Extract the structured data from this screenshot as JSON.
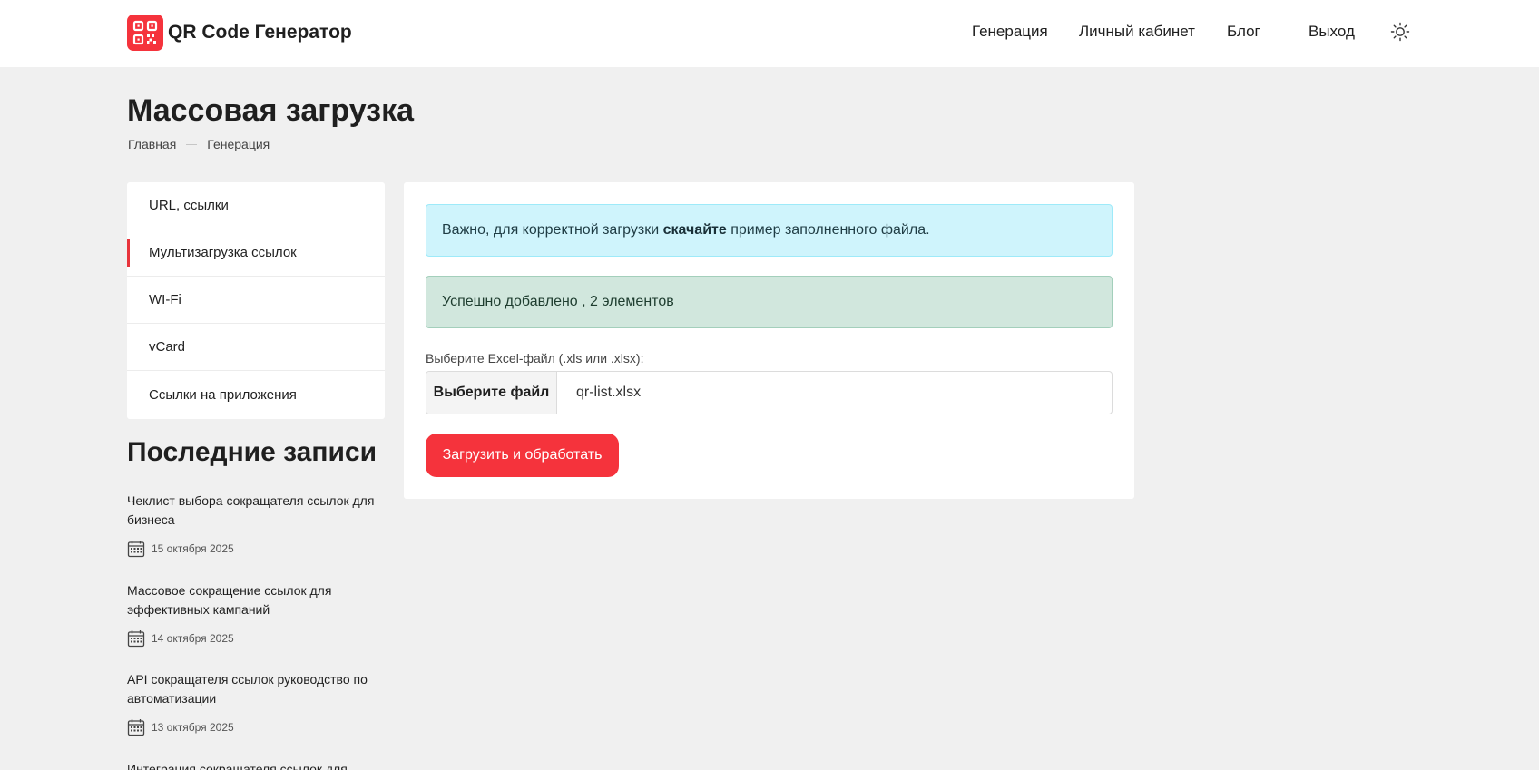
{
  "header": {
    "brand": "QR Code Генератор",
    "logo_icon": "qr-code-icon",
    "brand_color": "#f5333c",
    "nav": [
      "Генерация",
      "Личный кабинет",
      "Блог",
      "Выход"
    ],
    "theme_icon": "sun-icon"
  },
  "page": {
    "title": "Массовая загрузка",
    "breadcrumb": [
      "Главная",
      "Генерация"
    ]
  },
  "sidebar": {
    "items": [
      {
        "label": "URL, ссылки",
        "active": false
      },
      {
        "label": "Мультизагрузка ссылок",
        "active": true
      },
      {
        "label": "WI-Fi",
        "active": false
      },
      {
        "label": "vCard",
        "active": false
      },
      {
        "label": "Ссылки на приложения",
        "active": false
      }
    ]
  },
  "recent": {
    "title": "Последние записи",
    "posts": [
      {
        "title": "Чеклист выбора сокращателя ссылок для бизнеса",
        "date": "15 октября 2025"
      },
      {
        "title": "Массовое сокращение ссылок для эффективных кампаний",
        "date": "14 октября 2025"
      },
      {
        "title": "API сокращателя ссылок руководство по автоматизации",
        "date": "13 октября 2025"
      },
      {
        "title": "Интеграция сокращателя ссылок для",
        "date": ""
      }
    ]
  },
  "upload": {
    "info_prefix": "Важно, для корректной загрузки ",
    "info_link": "скачайте",
    "info_suffix": " пример заполненного файла.",
    "success": "Успешно добавлено , 2 элементов",
    "file_label": "Выберите Excel-файл (.xls или .xlsx):",
    "file_button": "Выберите файл",
    "file_name": "qr-list.xlsx",
    "submit": "Загрузить и обработать"
  }
}
